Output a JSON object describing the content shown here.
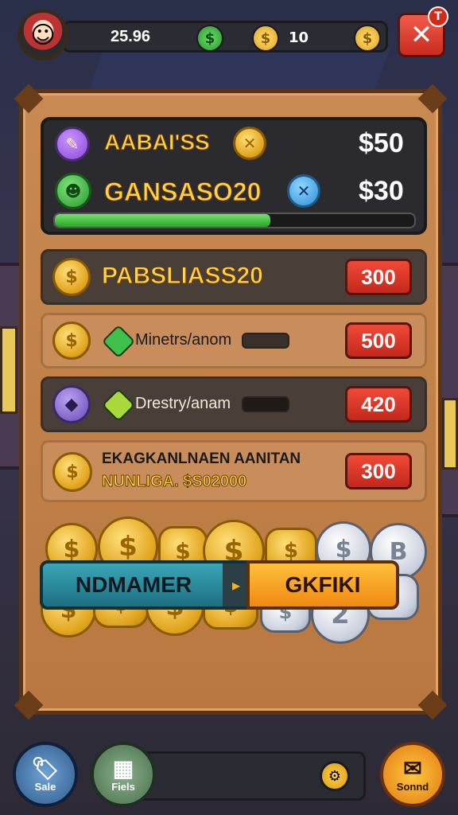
{
  "top_bar": {
    "balance": "25.96",
    "gems": "10",
    "close_badge": "T"
  },
  "stats": [
    {
      "label": "AABAI'SS",
      "value": "$50"
    },
    {
      "label": "GANSASO20",
      "value": "$30"
    }
  ],
  "stats_progress": 0.6,
  "offers": [
    {
      "title": "PABSLIASS20",
      "price": "300"
    },
    {
      "title": "Minetrs/anom",
      "price": "500"
    },
    {
      "title": "Drestry/anam",
      "price": "420"
    },
    {
      "title_line1": "EKAGKANLNAEN AANITAN",
      "title_line2": "NUNLIGA. $S02000",
      "price": "300"
    }
  ],
  "actions": {
    "left_label": "NDMAMER",
    "right_label": "GKFIKI"
  },
  "bottom_nav": {
    "sale_label": "Sale",
    "fields_label": "Fiels",
    "sound_label": "Sonnd"
  },
  "colors": {
    "panel": "#c98a52",
    "price_button": "#d9352a",
    "progress": "#3dbb38",
    "action_left": "#2b8fa2",
    "action_right": "#f5a021"
  }
}
